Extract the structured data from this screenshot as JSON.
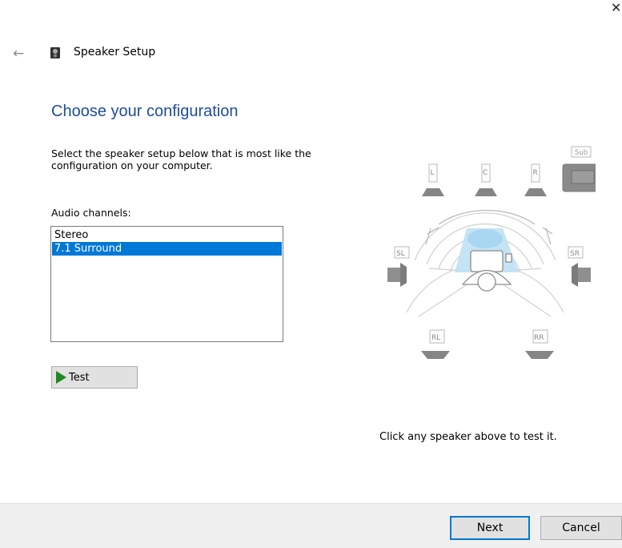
{
  "window": {
    "title": "Speaker Setup",
    "close_glyph": "✕",
    "back_glyph": "←"
  },
  "heading": "Choose your configuration",
  "description": "Select the speaker setup below that is most like the configuration on your computer.",
  "audio_channels": {
    "label": "Audio channels:",
    "options": [
      "Stereo",
      "7.1 Surround"
    ],
    "selected": "7.1 Surround"
  },
  "test_button": {
    "label": "Test",
    "icon": "play-icon"
  },
  "speakers": {
    "front_left": "L",
    "center": "C",
    "front_right": "R",
    "sub": "Sub",
    "side_left": "SL",
    "side_right": "SR",
    "rear_left": "RL",
    "rear_right": "RR"
  },
  "hint": "Click any speaker above to test it.",
  "footer": {
    "next_label": "Next",
    "cancel_label": "Cancel"
  }
}
